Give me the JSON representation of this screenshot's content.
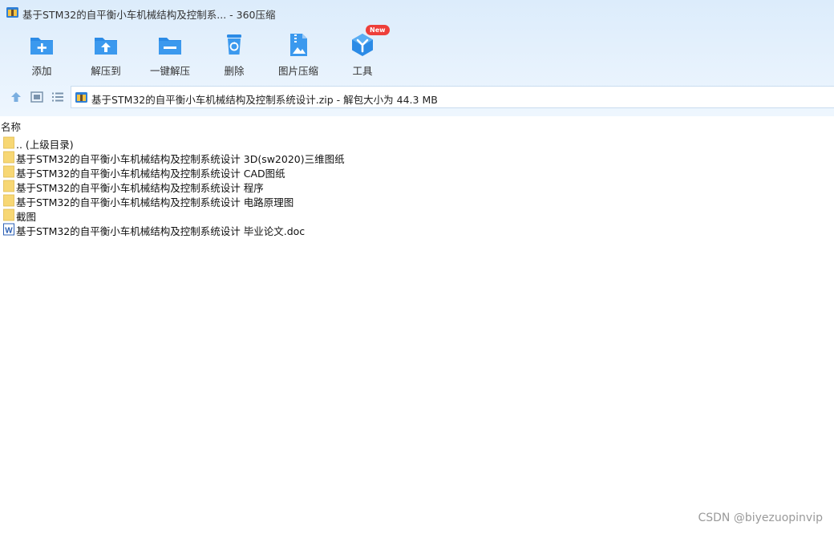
{
  "window": {
    "title": "基于STM32的自平衡小车机械结构及控制系... - 360压缩"
  },
  "toolbar": {
    "add": "添加",
    "extract_to": "解压到",
    "one_click_extract": "一键解压",
    "delete": "删除",
    "image_compress": "图片压缩",
    "tools": "工具",
    "tools_badge": "New"
  },
  "address": {
    "text": "基于STM32的自平衡小车机械结构及控制系统设计.zip - 解包大小为 44.3 MB"
  },
  "columns": {
    "name": "名称"
  },
  "files": [
    {
      "name": ".. (上级目录)",
      "icon": "folder-icon"
    },
    {
      "name": "基于STM32的自平衡小车机械结构及控制系统设计 3D(sw2020)三维图纸",
      "icon": "folder-icon"
    },
    {
      "name": "基于STM32的自平衡小车机械结构及控制系统设计 CAD图纸",
      "icon": "folder-icon"
    },
    {
      "name": "基于STM32的自平衡小车机械结构及控制系统设计 程序",
      "icon": "folder-icon"
    },
    {
      "name": "基于STM32的自平衡小车机械结构及控制系统设计 电路原理图",
      "icon": "folder-icon"
    },
    {
      "name": "截图",
      "icon": "folder-icon"
    },
    {
      "name": "基于STM32的自平衡小车机械结构及控制系统设计 毕业论文.doc",
      "icon": "word-doc-icon"
    }
  ],
  "watermark": "CSDN @biyezuopinvip",
  "colors": {
    "accent_blue": "#2b8be6",
    "folder": "#f7d774",
    "header_bg": "#e2effc"
  }
}
